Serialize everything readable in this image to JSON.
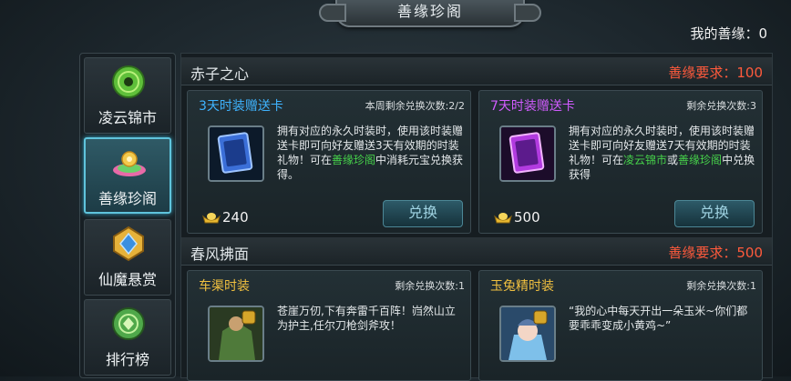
{
  "window": {
    "title": "善缘珍阁"
  },
  "header": {
    "goodwill": "我的善缘：0"
  },
  "sidebar": {
    "items": [
      {
        "label": "凌云锦市",
        "icon": "jade-coin-icon"
      },
      {
        "label": "善缘珍阁",
        "icon": "lotus-treasure-icon",
        "active": true
      },
      {
        "label": "仙魔悬赏",
        "icon": "crystal-emblem-icon"
      },
      {
        "label": "排行榜",
        "icon": "jade-medal-icon"
      }
    ]
  },
  "sections": [
    {
      "name": "赤子之心",
      "requirement": "善缘要求：100",
      "cards": [
        {
          "title": "3天时装赠送卡",
          "remaining": "本周剩余兑换次数:2/2",
          "icon": "blue-gift-card-icon",
          "desc_pre": "拥有对应的永久时装时，使用该时装赠送卡即可向好友赠送3天有效期的时装礼物！可在",
          "desc_hl1": "善缘珍阁",
          "desc_mid": "中消耗元宝兑换获得。",
          "desc_hl2": "",
          "desc_end": "",
          "price": "240",
          "button": "兑换"
        },
        {
          "title": "7天时装赠送卡",
          "remaining": "剩余兑换次数:3",
          "icon": "purple-gift-card-icon",
          "desc_pre": "拥有对应的永久时装时，使用该时装赠送卡即可向好友赠送7天有效期的时装礼物！可在",
          "desc_hl1": "凌云锦市",
          "desc_mid": "或",
          "desc_hl2": "善缘珍阁",
          "desc_end": "中兑换获得",
          "price": "500",
          "button": "兑换"
        }
      ]
    },
    {
      "name": "春风拂面",
      "requirement": "善缘要求：500",
      "cards": [
        {
          "title": "车渠时装",
          "remaining": "剩余兑换次数:1",
          "icon": "warrior-costume-icon",
          "desc": "苍崖万仞,下有奔雷千百阵！岿然山立为护主,任尔刀枪剑斧攻！"
        },
        {
          "title": "玉兔精时装",
          "remaining": "剩余兑换次数:1",
          "icon": "rabbit-costume-icon",
          "desc": "“我的心中每天开出一朵玉米~你们都要乖乖变成小黄鸡~”"
        }
      ]
    }
  ],
  "colors": {
    "requirement": "#ff5a3c",
    "highlight": "#46d14a",
    "blue_title": "#3fb4ff",
    "purple_title": "#d15cff",
    "gold_title": "#f0c040"
  }
}
